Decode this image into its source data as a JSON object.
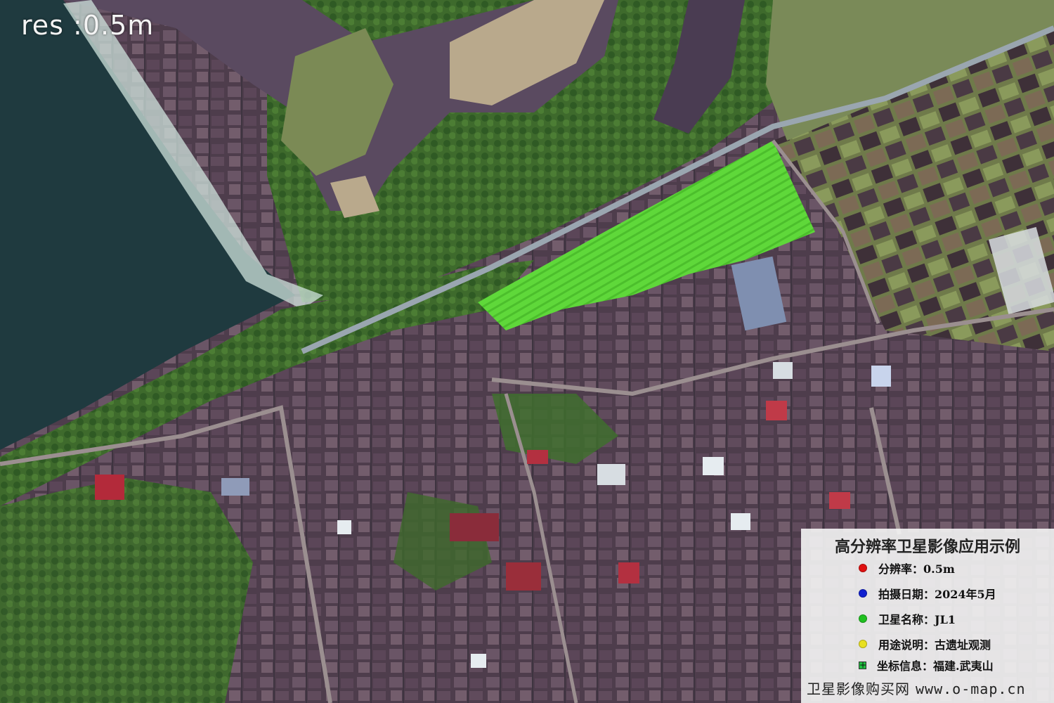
{
  "resolution_label": "res :0.5m",
  "legend": {
    "title": "高分辨率卫星影像应用示例",
    "items": [
      {
        "label": "分辨率：0.5m",
        "color": "#e01010",
        "marker": "dot"
      },
      {
        "label": "拍摄日期：2024年5月",
        "color": "#1020d0",
        "marker": "dot"
      },
      {
        "label": "卫星名称：JL1",
        "color": "#20c020",
        "marker": "dot"
      },
      {
        "label": "用途说明：古遗址观测",
        "color": "#e8e020",
        "marker": "dot"
      },
      {
        "label": "坐标信息：福建.武夷山",
        "color": "#20c040",
        "marker": "crosshair-square"
      }
    ],
    "footer_name": "卫星影像购买网",
    "footer_url": "www.o-map.cn"
  },
  "colors": {
    "water": "#1f3a3f",
    "river": "#5a4a60",
    "crop_field": "#5fd83a",
    "roof": "#5e4a5a"
  }
}
